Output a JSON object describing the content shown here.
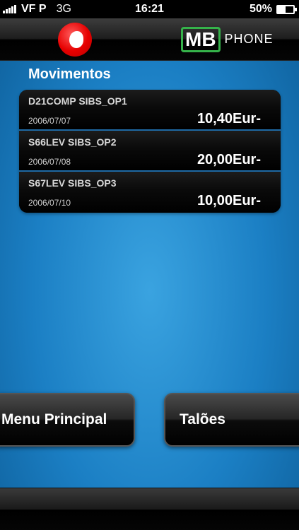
{
  "status_bar": {
    "carrier": "VF P",
    "network": "3G",
    "time": "16:21",
    "battery": "50%",
    "battery_level": 0.5
  },
  "header": {
    "left_logo": "vodafone-logo",
    "right_logo_mb": "MB",
    "right_logo_phone": "PHONE"
  },
  "section_title": "Movimentos",
  "transactions": [
    {
      "description": "D21COMP SIBS_OP1",
      "date": "2006/07/07",
      "amount": "10,40Eur-"
    },
    {
      "description": "S66LEV SIBS_OP2",
      "date": "2006/07/08",
      "amount": "20,00Eur-"
    },
    {
      "description": "S67LEV SIBS_OP3",
      "date": "2006/07/10",
      "amount": "10,00Eur-"
    }
  ],
  "buttons": {
    "menu_principal": "Menu Principal",
    "taloes": "Talões"
  },
  "colors": {
    "background": "#1b7fc4",
    "accent_green": "#35b34a",
    "vodafone_red": "#e60000",
    "row_divider": "#1e6aa5"
  }
}
